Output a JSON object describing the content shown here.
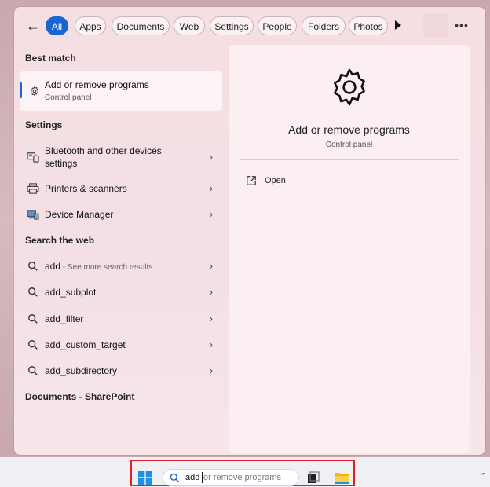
{
  "filters": {
    "tabs": [
      {
        "label": "All",
        "active": true
      },
      {
        "label": "Apps"
      },
      {
        "label": "Documents"
      },
      {
        "label": "Web"
      },
      {
        "label": "Settings"
      },
      {
        "label": "People"
      },
      {
        "label": "Folders"
      },
      {
        "label": "Photos"
      }
    ],
    "back_icon": "back-arrow-icon",
    "play_icon": "play-icon",
    "more_icon": "more-options-icon"
  },
  "sections": {
    "best_match": "Best match",
    "settings": "Settings",
    "search_web": "Search the web",
    "documents": "Documents - SharePoint"
  },
  "best_match": {
    "title": "Add or remove programs",
    "subtitle": "Control panel",
    "icon": "gear-icon"
  },
  "settings_items": [
    {
      "line1": "Bluetooth and other devices",
      "line2": "settings",
      "icon": "bluetooth-devices-icon"
    },
    {
      "label": "Printers & scanners",
      "icon": "printer-icon"
    },
    {
      "label": "Device Manager",
      "icon": "device-manager-icon"
    }
  ],
  "web_items": [
    {
      "label": "add",
      "sub": " - See more search results"
    },
    {
      "label": "add_subplot"
    },
    {
      "label": "add_filter"
    },
    {
      "label": "add_custom_target"
    },
    {
      "label": "add_subdirectory"
    }
  ],
  "preview": {
    "title": "Add or remove programs",
    "subtitle": "Control panel",
    "open_label": "Open",
    "icon": "gear-icon"
  },
  "taskbar": {
    "typed": "add",
    "placeholder": "or remove programs",
    "highlight_color": "#e0202a"
  },
  "colors": {
    "accent": "#1a66d1"
  }
}
